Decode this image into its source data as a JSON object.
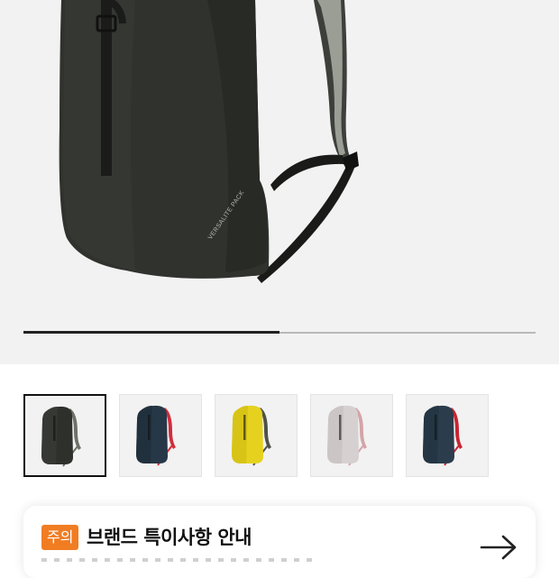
{
  "gallery": {
    "hero_product_label": "VERSALITE PACK",
    "progress_fraction": 0.5
  },
  "thumbnails": [
    {
      "name": "black",
      "body_color": "#2e302c",
      "accent_color": "#3a3c38",
      "strap_color": "#6d7168",
      "selected": true
    },
    {
      "name": "navy",
      "body_color": "#263847",
      "accent_color": "#1f2d39",
      "strap_color": "#d12d3c",
      "selected": false
    },
    {
      "name": "yellow",
      "body_color": "#e6d21e",
      "accent_color": "#d1bd12",
      "strap_color": "#4f5248",
      "selected": false
    },
    {
      "name": "white",
      "body_color": "#d6d0d0",
      "accent_color": "#c7c1c1",
      "strap_color": "#d3a4a8",
      "selected": false
    },
    {
      "name": "navy-red",
      "body_color": "#2b3d4d",
      "accent_color": "#22323f",
      "strap_color": "#c92432",
      "selected": false
    }
  ],
  "notice": {
    "badge": "주의",
    "title": "브랜드 특이사항 안내",
    "arrow_icon": "arrow-right-icon"
  },
  "colors": {
    "badge_bg": "#f17d23"
  }
}
